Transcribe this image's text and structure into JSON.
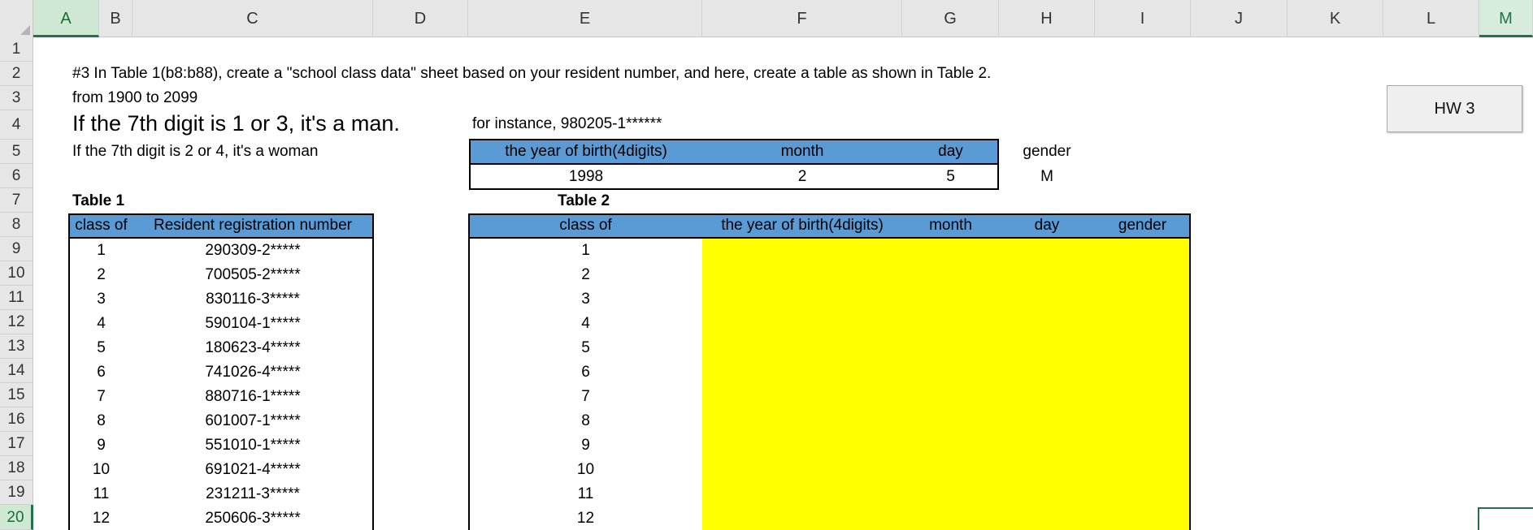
{
  "columns": [
    "A",
    "B",
    "C",
    "D",
    "E",
    "F",
    "G",
    "H",
    "I",
    "J",
    "K",
    "L",
    "M"
  ],
  "rows": [
    "1",
    "2",
    "3",
    "4",
    "5",
    "6",
    "7",
    "8",
    "9",
    "10",
    "11",
    "12",
    "13",
    "14",
    "15",
    "16",
    "17",
    "18",
    "19",
    "20"
  ],
  "notes": {
    "line2": "#3 In Table 1(b8:b88), create a \"school class data\" sheet based on your resident number, and here, create a table as shown in Table 2.",
    "line3": "from 1900 to 2099",
    "line4": "If the 7th digit is 1 or 3, it's a man.",
    "line5": "If the 7th digit is 2 or 4, it's a woman",
    "example": "for instance, 980205-1******"
  },
  "example_table": {
    "headers": [
      "the year of birth(4digits)",
      "month",
      "day"
    ],
    "values": [
      "1998",
      "2",
      "5"
    ],
    "gender_label": "gender",
    "gender_value": "M"
  },
  "table1": {
    "title": "Table 1",
    "headers": [
      "class of",
      "Resident registration number"
    ],
    "rows": [
      [
        "1",
        "290309-2*****"
      ],
      [
        "2",
        "700505-2*****"
      ],
      [
        "3",
        "830116-3*****"
      ],
      [
        "4",
        "590104-1*****"
      ],
      [
        "5",
        "180623-4*****"
      ],
      [
        "6",
        "741026-4*****"
      ],
      [
        "7",
        "880716-1*****"
      ],
      [
        "8",
        "601007-1*****"
      ],
      [
        "9",
        "551010-1*****"
      ],
      [
        "10",
        "691021-4*****"
      ],
      [
        "11",
        "231211-3*****"
      ],
      [
        "12",
        "250606-3*****"
      ]
    ]
  },
  "table2": {
    "title": "Table 2",
    "headers": [
      "class of",
      "the year of birth(4digits)",
      "month",
      "day",
      "gender"
    ],
    "classes": [
      "1",
      "2",
      "3",
      "4",
      "5",
      "6",
      "7",
      "8",
      "9",
      "10",
      "11",
      "12"
    ],
    "fill_color": "#ffff00",
    "header_color": "#5b9bd5"
  },
  "button": {
    "label": "HW 3"
  }
}
